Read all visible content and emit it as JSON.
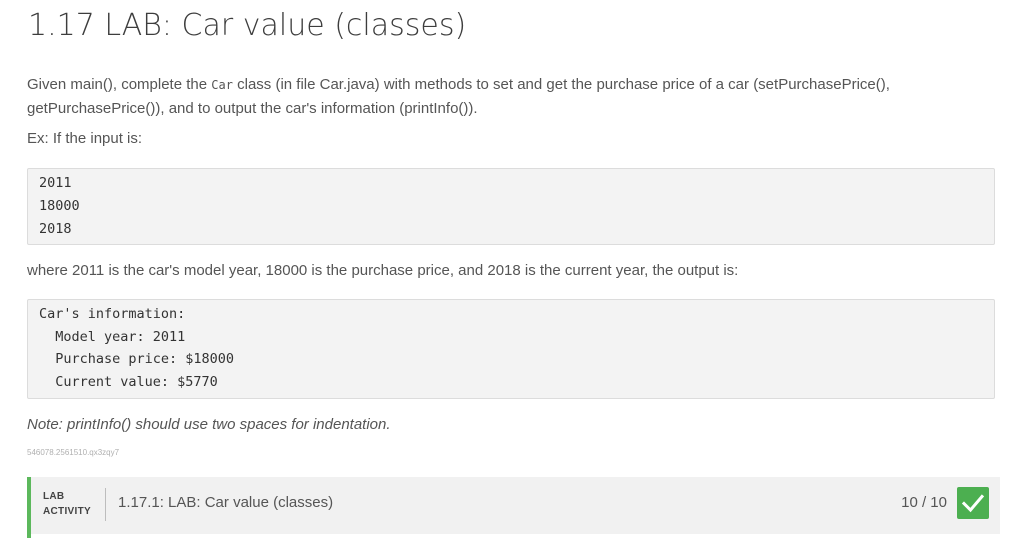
{
  "title": "1.17 LAB: Car value (classes)",
  "description": {
    "before_code": "Given main(), complete the ",
    "code": "Car",
    "after_code": " class (in file Car.java) with methods to set and get the purchase price of a car (setPurchasePrice(), getPurchasePrice()), and to output the car's information (printInfo())."
  },
  "example_intro": "Ex: If the input is:",
  "input_lines": [
    "2011",
    "18000",
    "2018"
  ],
  "output_intro": "where 2011 is the car's model year, 18000 is the purchase price, and 2018 is the current year, the output is:",
  "output_lines": [
    "Car's information:",
    "  Model year: 2011",
    "  Purchase price: $18000",
    "  Current value: $5770"
  ],
  "note": "Note: printInfo() should use two spaces for indentation.",
  "tracking_id": "546078.2561510.qx3zqy7",
  "activity": {
    "type_line1": "LAB",
    "type_line2": "ACTIVITY",
    "name": "1.17.1: LAB: Car value (classes)",
    "score": "10 / 10",
    "status_icon": "check-icon",
    "accent_color": "#5cb85c"
  }
}
